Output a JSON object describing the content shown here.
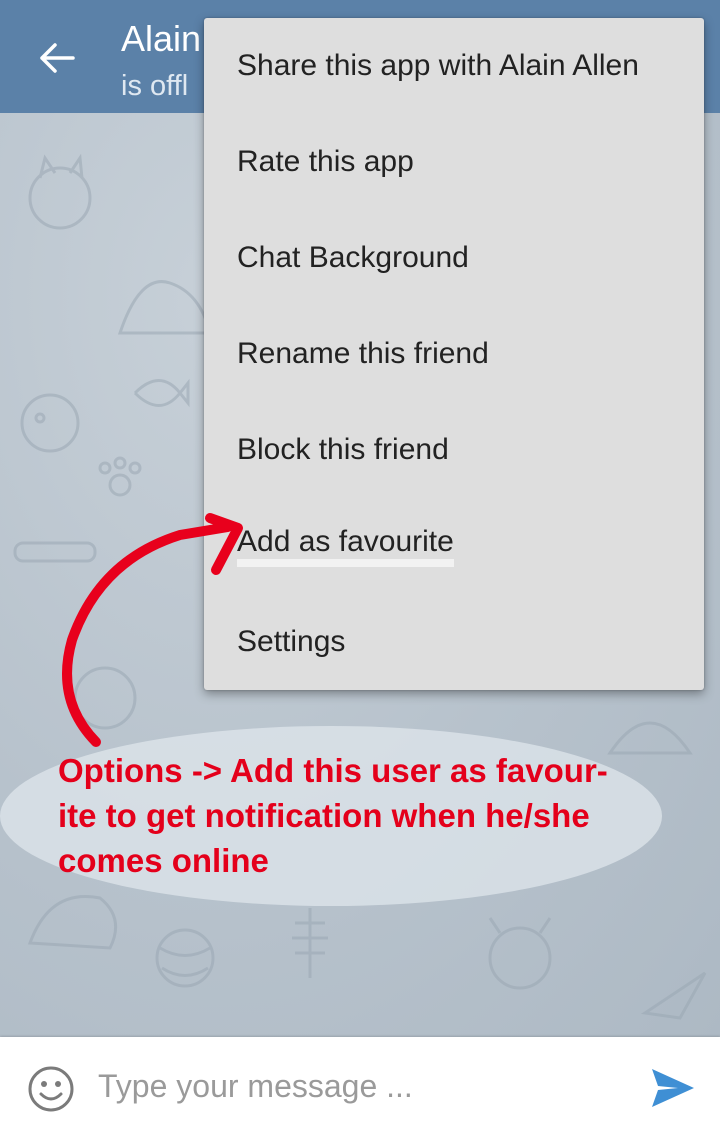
{
  "header": {
    "title": "Alain",
    "subtitle": "is offl",
    "back_icon": "arrow-left-icon",
    "background_color": "#5b81a8"
  },
  "menu": {
    "items": [
      {
        "label": "Share this app with Alain Allen"
      },
      {
        "label": "Rate this app"
      },
      {
        "label": "Chat Background"
      },
      {
        "label": "Rename this friend"
      },
      {
        "label": "Block this friend"
      },
      {
        "label": "Add as favourite"
      },
      {
        "label": "Settings"
      }
    ]
  },
  "annotation": {
    "text": "Options -> Add this user as favour-ite to get notification when he/she comes online",
    "line1": "Options -> Add this user as favour-",
    "line2": "ite to get notification when he/she",
    "line3": "comes online",
    "color": "#e4001b"
  },
  "composer": {
    "placeholder": "Type your message ...",
    "emoji_icon": "smiley-icon",
    "send_icon": "send-icon",
    "send_color": "#3f8fd4"
  }
}
